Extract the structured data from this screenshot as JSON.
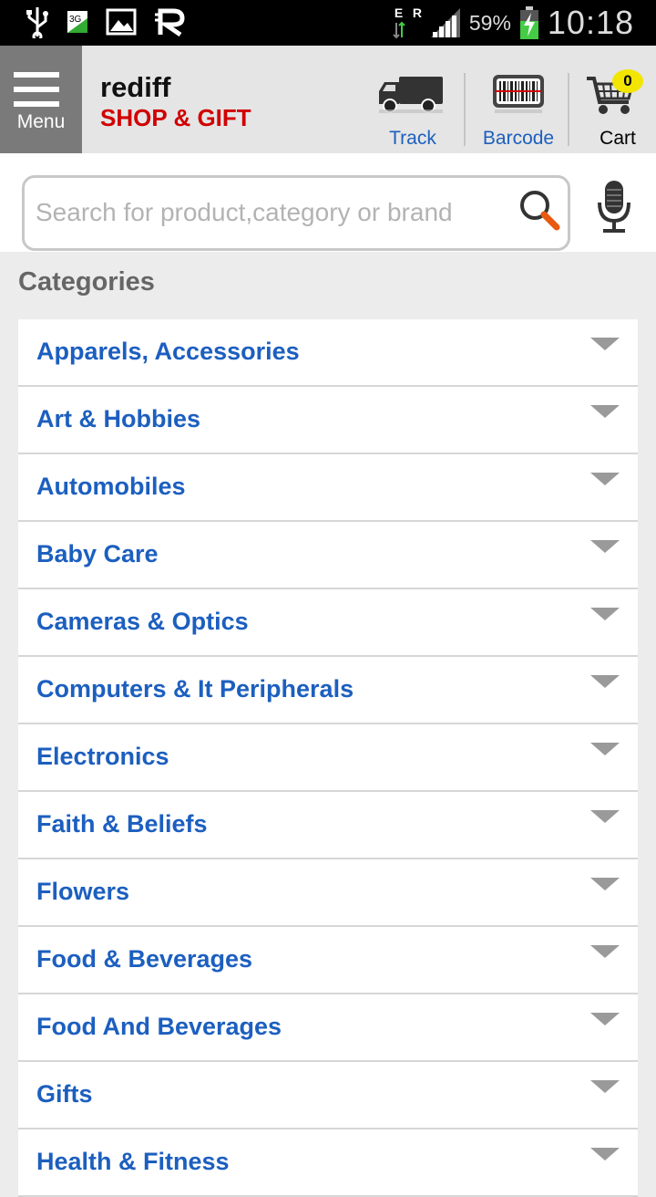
{
  "status_bar": {
    "net_type": "3G",
    "net_e": "E",
    "net_r": "R",
    "battery": "59%",
    "time": "10:18"
  },
  "header": {
    "menu_label": "Menu",
    "brand_name": "rediff",
    "brand_tagline": "SHOP & GIFT",
    "track_label": "Track",
    "barcode_label": "Barcode",
    "cart_label": "Cart",
    "cart_count": "0"
  },
  "search": {
    "placeholder": "Search for product,category or brand",
    "value": ""
  },
  "categories": {
    "heading": "Categories",
    "items": [
      {
        "label": "Apparels, Accessories"
      },
      {
        "label": "Art & Hobbies"
      },
      {
        "label": "Automobiles"
      },
      {
        "label": "Baby Care"
      },
      {
        "label": "Cameras & Optics"
      },
      {
        "label": "Computers & It Peripherals"
      },
      {
        "label": "Electronics"
      },
      {
        "label": "Faith & Beliefs"
      },
      {
        "label": "Flowers"
      },
      {
        "label": "Food & Beverages"
      },
      {
        "label": "Food And Beverages"
      },
      {
        "label": "Gifts"
      },
      {
        "label": "Health & Fitness"
      }
    ]
  },
  "colors": {
    "brand_red": "#d10000",
    "link_blue": "#1c5fbf",
    "cart_badge": "#f2e600",
    "menu_bg": "#7a7a7a"
  }
}
